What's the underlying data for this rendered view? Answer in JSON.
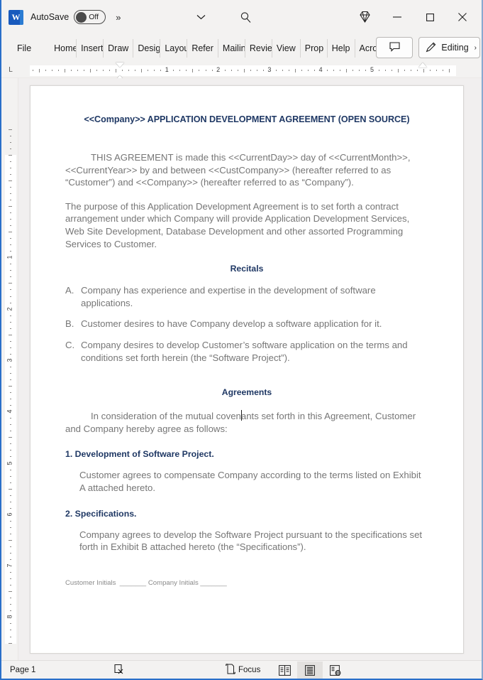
{
  "titlebar": {
    "app_icon": "word-logo",
    "autosave_label": "AutoSave",
    "autosave_state": "Off",
    "overflow_label": "»",
    "chevron_icon": "chevron-down-icon",
    "search_icon": "search-icon",
    "diamond_icon": "diamond-icon",
    "minimize_label": "−",
    "maximize_label": "□",
    "close_label": "✕"
  },
  "ribbon": {
    "tabs": [
      {
        "label": "File",
        "full": "File"
      },
      {
        "label": "Home",
        "full": "Home"
      },
      {
        "label": "Insert",
        "full": "Insert"
      },
      {
        "label": "Draw",
        "full": "Draw"
      },
      {
        "label": "Design",
        "full": "Design"
      },
      {
        "label": "Layout",
        "full": "Layout"
      },
      {
        "label": "Refer",
        "full": "References"
      },
      {
        "label": "Mailin",
        "full": "Mailings"
      },
      {
        "label": "Revie",
        "full": "Review"
      },
      {
        "label": "View",
        "full": "View"
      },
      {
        "label": "Prop",
        "full": "Properties"
      },
      {
        "label": "Help",
        "full": "Help"
      },
      {
        "label": "Acrob",
        "full": "Acrobat"
      }
    ],
    "comments_icon": "comment-icon",
    "editing_icon": "pencil-icon",
    "editing_label": "Editing",
    "editing_caret": "›"
  },
  "ruler": {
    "corner_tab_label": "L",
    "horizontal_numbers": [
      "1",
      "2",
      "3",
      "4",
      "5"
    ],
    "vertical_numbers": [
      "1",
      "2",
      "3",
      "4",
      "5",
      "6",
      "7",
      "8"
    ],
    "left_indent_icon": "first-line-indent-marker",
    "right_indent_icon": "right-indent-marker"
  },
  "document": {
    "title": "<<Company>> APPLICATION DEVELOPMENT AGREEMENT (OPEN SOURCE)",
    "para_1": "THIS AGREEMENT is made this <<CurrentDay>> day of <<CurrentMonth>>, <<CurrentYear>> by and between <<CustCompany>> (hereafter referred to as “Customer”) and <<Company>> (hereafter referred to as “Company”).",
    "para_2": "The purpose of this Application Development Agreement is to set forth a contract arrangement under which Company will provide Application Development Services, Web Site Development, Database Development and other assorted Programming Services to Customer.",
    "recitals_heading": "Recitals",
    "recitals": [
      {
        "marker": "A.",
        "text": "Company has experience and expertise in the development of software applications."
      },
      {
        "marker": "B.",
        "text": "Customer desires to have Company develop a software application for it."
      },
      {
        "marker": "C.",
        "text": "Company desires to develop Customer’s software application on the terms and conditions set forth herein (the “Software Project”)."
      }
    ],
    "agreements_heading": "Agreements",
    "agreements_intro": "In consideration of the mutual covenants set forth in this Agreement, Customer and Company hereby agree as follows:",
    "sections": [
      {
        "heading": "1. Development of Software Project.",
        "body": "Customer agrees to compensate Company according to the terms listed on Exhibit A attached hereto."
      },
      {
        "heading": "2. Specifications.",
        "body": "Company agrees to develop the Software Project pursuant to the specifications set forth in Exhibit B attached hereto (the “Specifications”)."
      }
    ],
    "footer_customer_initials": "Customer Initials",
    "footer_customer_blank": "_______",
    "footer_company_initials": "Company Initials",
    "footer_company_blank": "_______"
  },
  "statusbar": {
    "page_label": "Page 1",
    "proofing_icon": "proofing-errors-icon",
    "focus_icon": "focus-mode-icon",
    "focus_label": "Focus",
    "view_read_icon": "read-mode-icon",
    "view_print_icon": "print-layout-icon",
    "view_web_icon": "web-layout-icon"
  },
  "colors": {
    "heading_blue": "#1f3864",
    "body_gray": "#767676",
    "window_chrome": "#f3f2f1",
    "accent_border": "#2a6fc9",
    "word_brand": "#185abd"
  }
}
